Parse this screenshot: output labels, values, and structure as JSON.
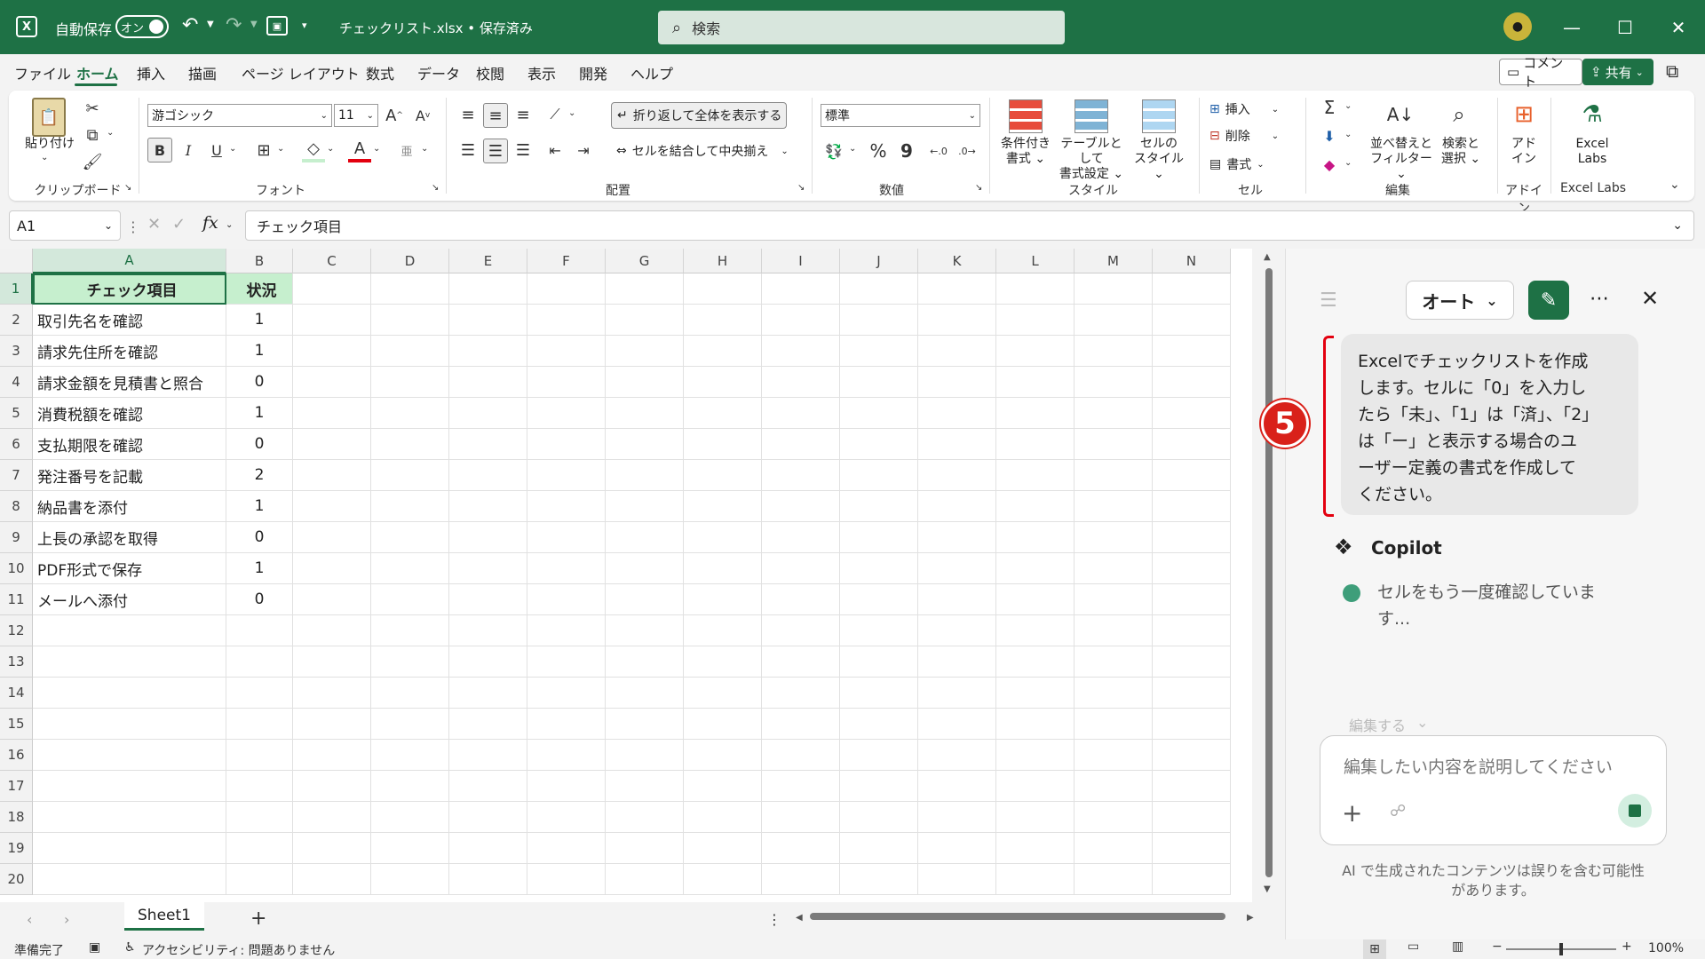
{
  "titlebar": {
    "autosave_label": "自動保存",
    "autosave_state": "オン",
    "filename": "チェックリスト.xlsx • 保存済み",
    "search_placeholder": "検索"
  },
  "menu": {
    "items": [
      "ファイル",
      "ホーム",
      "挿入",
      "描画",
      "ページ レイアウト",
      "数式",
      "データ",
      "校閲",
      "表示",
      "開発",
      "ヘルプ"
    ],
    "active": "ホーム",
    "comment_button": "コメント",
    "share_button": "共有"
  },
  "ribbon": {
    "clipboard": {
      "paste": "貼り付け",
      "group": "クリップボード"
    },
    "font": {
      "name": "游ゴシック",
      "size": "11",
      "bold": "B",
      "italic": "I",
      "underline": "U",
      "group": "フォント"
    },
    "alignment": {
      "wrap": "折り返して全体を表示する",
      "merge": "セルを結合して中央揃え",
      "group": "配置"
    },
    "number": {
      "format": "標準",
      "percent": "%",
      "comma": "9",
      "group": "数値"
    },
    "styles": {
      "conditional": "条件付き書式",
      "table": "テーブルとして書式設定",
      "cellstyle": "セルのスタイル",
      "group": "スタイル"
    },
    "cells": {
      "insert": "挿入",
      "delete": "削除",
      "format": "書式",
      "group": "セル"
    },
    "editing": {
      "sort": "並べ替えとフィルター",
      "find": "検索と選択",
      "group": "編集"
    },
    "addins": {
      "label": "アドイン",
      "group": "アドイン"
    },
    "labs": {
      "label": "Excel Labs",
      "group": "Excel Labs"
    }
  },
  "formulabar": {
    "namebox": "A1",
    "fx": "fx",
    "content": "チェック項目"
  },
  "grid": {
    "columns": [
      "A",
      "B",
      "C",
      "D",
      "E",
      "F",
      "G",
      "H",
      "I",
      "J",
      "K",
      "L",
      "M",
      "N"
    ],
    "rows": [
      "1",
      "2",
      "3",
      "4",
      "5",
      "6",
      "7",
      "8",
      "9",
      "10",
      "11",
      "12",
      "13",
      "14",
      "15",
      "16",
      "17",
      "18",
      "19",
      "20"
    ],
    "header": [
      "チェック項目",
      "状況"
    ],
    "data": [
      [
        "取引先名を確認",
        "1"
      ],
      [
        "請求先住所を確認",
        "1"
      ],
      [
        "請求金額を見積書と照合",
        "0"
      ],
      [
        "消費税額を確認",
        "1"
      ],
      [
        "支払期限を確認",
        "0"
      ],
      [
        "発注番号を記載",
        "2"
      ],
      [
        "納品書を添付",
        "1"
      ],
      [
        "上長の承認を取得",
        "0"
      ],
      [
        "PDF形式で保存",
        "1"
      ],
      [
        "メールへ添付",
        "0"
      ]
    ]
  },
  "sheet": {
    "tab": "Sheet1",
    "add": "+"
  },
  "statusbar": {
    "ready": "準備完了",
    "accessibility": "アクセシビリティ: 問題ありません",
    "zoom": "100%"
  },
  "copilot": {
    "mode": "オート",
    "user_message": "Excelでチェックリストを作成します。セルに「0」を入力したら「未」、「1」は「済」、「2」は「ー」と表示する場合のユーザー定義の書式を作成してください。",
    "user_lines": [
      "Excelでチェックリストを作成",
      "します。セルに「0」を入力し",
      "たら「未」、「1」は「済」、「2」",
      "は「ー」と表示する場合のユ",
      "ーザー定義の書式を作成して",
      "ください。"
    ],
    "badge": "5",
    "assistant_name": "Copilot",
    "status_lines": [
      "セルをもう一度確認していま",
      "す..."
    ],
    "edit_label": "編集する",
    "input_placeholder": "編集したい内容を説明してください",
    "disclaimer_lines": [
      "AI で生成されたコンテンツは誤りを含む可能性",
      "があります。"
    ]
  },
  "colors": {
    "accent": "#1e7145",
    "header_fill": "#c6efce",
    "annotation_red": "#e3000f"
  }
}
